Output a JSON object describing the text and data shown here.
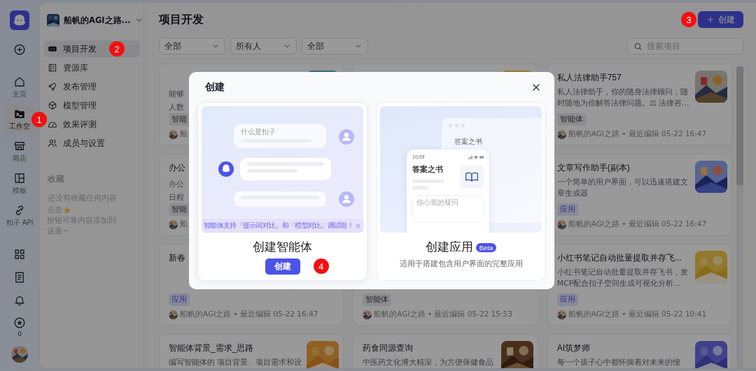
{
  "rail": {
    "items": [
      {
        "label": "主页",
        "selected": false
      },
      {
        "label": "工作空",
        "selected": true,
        "marker": "1"
      },
      {
        "label": "商店",
        "selected": false
      },
      {
        "label": "模板",
        "selected": false
      },
      {
        "label": "扣子 API",
        "selected": false
      }
    ],
    "favorites_count": "0"
  },
  "sidebar": {
    "space_name": "船帆的AGI之路...",
    "nav": [
      {
        "label": "项目开发",
        "selected": true,
        "marker": "2"
      },
      {
        "label": "资源库",
        "selected": false
      },
      {
        "label": "发布管理",
        "selected": false
      },
      {
        "label": "模型管理",
        "selected": false
      },
      {
        "label": "效果评测",
        "selected": false
      },
      {
        "label": "成员与设置",
        "selected": false
      }
    ],
    "favorites_title": "收藏",
    "empty_text": "还没有收藏任何内容",
    "hint_before": "点击",
    "hint_after": "按钮可将内容添加到",
    "hint_end": "这里~"
  },
  "main": {
    "title": "项目开发",
    "create_button": "创建",
    "create_marker": "3",
    "filters": [
      "全部",
      "所有人",
      "全部"
    ],
    "search": {
      "placeholder": "搜索项目"
    },
    "columns": [
      {
        "cards": [
          {
            "desc_lines": [
              "能够",
              "人数"
            ],
            "tag": {
              "label": "智能",
              "kind": "agent"
            },
            "meta": "船",
            "image": {
              "kind": "picture"
            }
          },
          {
            "title": "办公",
            "desc_lines": [
              "办公",
              "日程"
            ],
            "tag": {
              "label": "智能",
              "kind": "agent"
            },
            "meta": "船"
          },
          {
            "title": "新春",
            "tag": {
              "label": "应用",
              "kind": "app"
            },
            "meta": "船帆的AGI之路 • 最近编辑 05-22 16:47"
          },
          {
            "title": "智能体背景_需求_思路",
            "desc": "编写智能体的 项目背景、项目需求和设",
            "image": {
              "kind": "picture"
            }
          }
        ]
      },
      {
        "cards": [
          {
            "image": {
              "kind": "picture"
            }
          },
          {
            "tag": {
              "label": "智能体",
              "kind": "agent"
            },
            "meta": "船帆的AGI之路 • 最近编辑 05-22 15:53"
          },
          {
            "title": "药食同源查询",
            "desc": "中医药文化博大精深，为方便保健食品",
            "image": {
              "kind": "picture"
            }
          }
        ]
      },
      {
        "cards": [
          {
            "title": "私人法律助手757",
            "desc": "私人法律助手，你的随身法律顾问，随时随地为你解答法律问题。⚖ 法律咨...",
            "tag": {
              "label": "智能体",
              "kind": "agent"
            },
            "meta": "船帆的AGI之路 • 最近编辑 05-22 16:47",
            "image": {
              "kind": "picture"
            }
          },
          {
            "title": "文章写作助手(副本)",
            "desc": "一个简单的用户界面，可以迅速搭建文章生成器",
            "tag": {
              "label": "应用",
              "kind": "app"
            },
            "meta": "船帆的AGI之路 • 最近编辑 05-22 16:47",
            "image": {
              "kind": "picture"
            }
          },
          {
            "title": "小红书笔记自动批量提取并存飞...",
            "desc": "小红书笔记自动批量提取并存飞书，发MCP配合扣子空间生成可视化分析...",
            "tag": {
              "label": "应用",
              "kind": "app"
            },
            "meta": "船帆的AGI之路 • 最近编辑 05-22 10:41",
            "image": {
              "kind": "picture"
            }
          },
          {
            "title": "AI筑梦师",
            "desc": "每一个孩子心中都怀揣着对未来的憧",
            "image": {
              "kind": "picture"
            }
          }
        ]
      }
    ]
  },
  "modal": {
    "title": "创建",
    "options": [
      {
        "kind": "agent",
        "title": "创建智能体",
        "button": "创建",
        "marker": "4",
        "question": "什么是扣子",
        "banner": "智能体支持「提示词对比」和「模型对比」调试啦！"
      },
      {
        "kind": "app",
        "title": "创建应用",
        "badge": "Beta",
        "desc": "适用于搭建包含用户界面的完整应用",
        "window_title": "答案之书",
        "time": "10:09",
        "app_title": "答案之书",
        "input_placeholder": "你心底的疑问"
      }
    ]
  }
}
